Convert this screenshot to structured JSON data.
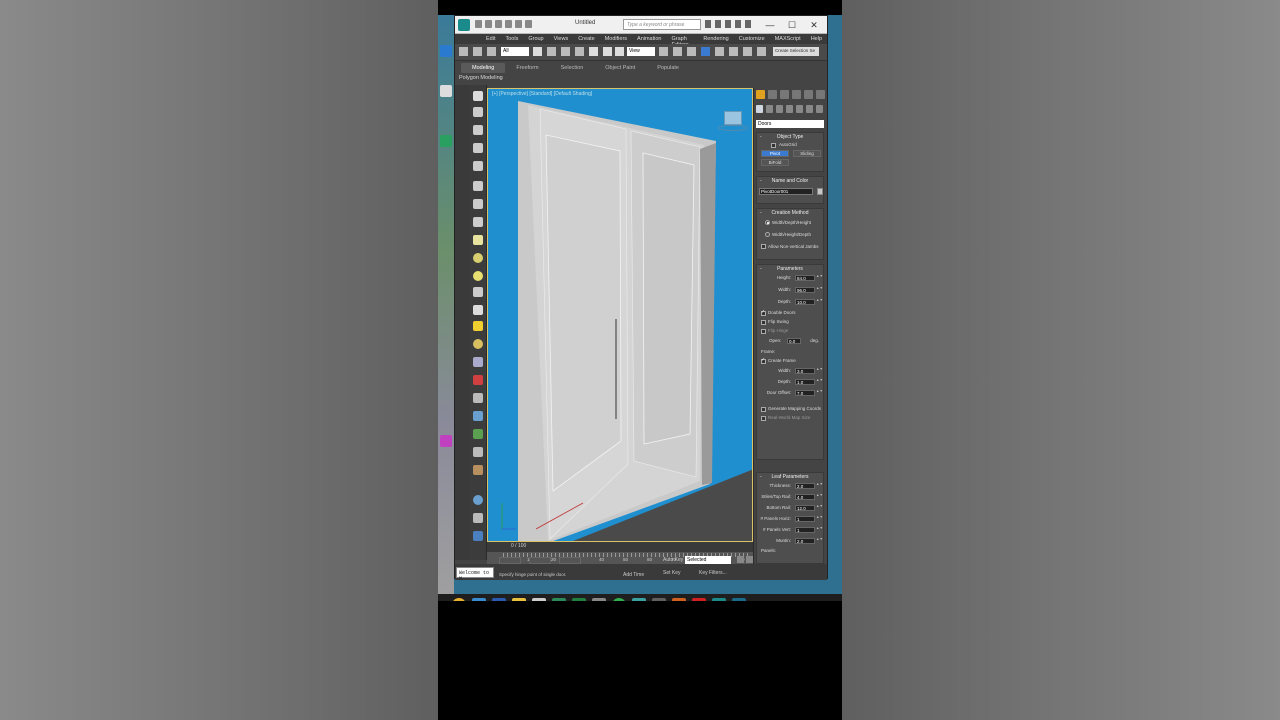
{
  "window": {
    "title": "Untitled",
    "search_placeholder": "Type a keyword or phrase",
    "controls": [
      "—",
      "☐",
      "✕"
    ]
  },
  "menu": [
    "Edit",
    "Tools",
    "Group",
    "Views",
    "Create",
    "Modifiers",
    "Animation",
    "Graph Editors",
    "Rendering",
    "Customize",
    "MAXScript",
    "Help"
  ],
  "toolbar": {
    "selection_filter": "All",
    "ref_coord": "View",
    "named_selection": "Create Selection Se"
  },
  "ribbon": {
    "tabs": [
      "Modeling",
      "Freeform",
      "Selection",
      "Object Paint",
      "Populate"
    ],
    "active_tab": "Modeling",
    "sub_label": "Polygon Modeling"
  },
  "viewport": {
    "label": "[+] [Perspective] [Standard] [Default Shading]"
  },
  "timeline": {
    "frame": "0 / 100",
    "ticks": [
      "0",
      "10",
      "20",
      "30",
      "40",
      "50",
      "60",
      "70",
      "80",
      "90",
      "100"
    ]
  },
  "status": {
    "maxscript": "Welcome to M",
    "message": "Specify hinge point of single door.",
    "add_time": "Add Time",
    "auto_key": "Auto Key",
    "auto_key_value": "Selected",
    "set_key": "Set Key",
    "key_filters": "Key Filters..."
  },
  "command_panel": {
    "category": "Doors",
    "object_type": {
      "title": "Object Type",
      "autogrid": "AutoGrid",
      "buttons": [
        "Pivot",
        "Sliding",
        "BiFold"
      ],
      "active": "Pivot"
    },
    "name_color": {
      "title": "Name and Color",
      "name": "PivotDoor001"
    },
    "creation_method": {
      "title": "Creation Method",
      "options": [
        "Width/Depth/Height",
        "Width/Height/Depth"
      ],
      "selected": 0,
      "allow_jambs": "Allow Non-vertical Jambs"
    },
    "parameters": {
      "title": "Parameters",
      "height_label": "Height:",
      "height": "84.0",
      "width_label": "Width:",
      "width": "96.0",
      "depth_label": "Depth:",
      "depth": "10.0",
      "double_doors": "Double Doors",
      "flip_swing": "Flip Swing",
      "flip_hinge": "Flip Hinge",
      "open_label": "Open:",
      "open": "0.0",
      "open_unit": "deg.",
      "frame_label": "Frame:",
      "create_frame": "Create Frame",
      "f_width_label": "Width:",
      "f_width": "3.0",
      "f_depth_label": "Depth:",
      "f_depth": "1.0",
      "door_offset_label": "Door Offset:",
      "door_offset": "7.0",
      "gen_mapping": "Generate Mapping Coords",
      "real_world": "Real-World Map Size"
    },
    "leaf": {
      "title": "Leaf Parameters",
      "thickness_label": "Thickness:",
      "thickness": "2.0",
      "stiles_label": "Stiles/Top Rail:",
      "stiles": "4.0",
      "bottom_label": "Bottom Rail:",
      "bottom": "12.0",
      "horiz_label": "# Panels Horiz:",
      "horiz": "1",
      "vert_label": "# Panels Vert:",
      "vert": "1",
      "muntin_label": "Muntin:",
      "muntin": "2.0",
      "panels_label": "Panels:"
    }
  },
  "colors": {
    "viewport_bg": "#1f8fcf",
    "active_button": "#3a7ad0",
    "ribbon_bg": "#444444"
  }
}
